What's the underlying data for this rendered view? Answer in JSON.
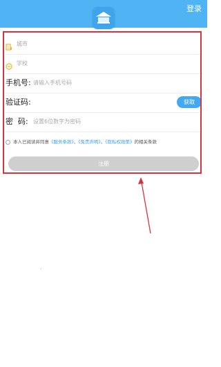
{
  "header": {
    "login_link": "登录"
  },
  "form": {
    "city_placeholder": "城市",
    "school_placeholder": "学校",
    "phone_label": "手机号:",
    "phone_placeholder": "请输入手机号码",
    "code_label": "验证码:",
    "code_button": "获取",
    "password_label": "密  码:",
    "password_placeholder": "设置6位数字为密码",
    "agreement": {
      "prefix": "本人已阅读并同意",
      "service": "《服务条款》",
      "sep1": "、",
      "disclaimer": "《免责声明》",
      "sep2": "、",
      "privacy": "《隐私权政策》",
      "suffix": "的相关条款"
    },
    "submit_label": "注册"
  },
  "colors": {
    "accent": "#4fb3f4",
    "button_blue": "#42a8ef",
    "annotation_red": "#d8333a",
    "disabled_button": "#cfcfcf"
  },
  "icons": [
    "school-logo-icon",
    "building-icon",
    "school-icon",
    "radio-icon"
  ]
}
